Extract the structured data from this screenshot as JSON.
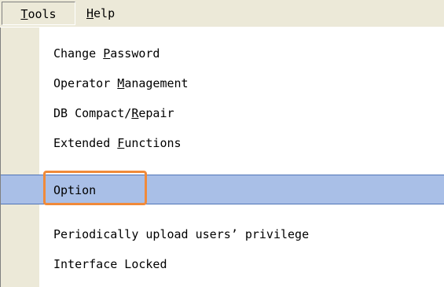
{
  "menubar": {
    "tools": {
      "pre": "",
      "key": "T",
      "post": "ools"
    },
    "help": {
      "pre": "",
      "key": "H",
      "post": "elp"
    }
  },
  "tools_menu": {
    "items": [
      {
        "pre": "Change ",
        "key": "P",
        "post": "assword",
        "highlighted": false
      },
      {
        "pre": "Operator ",
        "key": "M",
        "post": "anagement",
        "highlighted": false
      },
      {
        "pre": "DB Compact/",
        "key": "R",
        "post": "epair",
        "highlighted": false
      },
      {
        "pre": "Extended ",
        "key": "F",
        "post": "unctions",
        "highlighted": false
      },
      {
        "pre": "Option",
        "key": "",
        "post": "",
        "highlighted": true
      },
      {
        "pre": "Periodically upload users’ privilege",
        "key": "",
        "post": "",
        "highlighted": false
      },
      {
        "pre": "Interface Locked",
        "key": "",
        "post": "",
        "highlighted": false
      }
    ]
  },
  "colors": {
    "menu_background": "#ece9d8",
    "highlight": "#a9bfe7",
    "callout": "#f08a3a"
  }
}
